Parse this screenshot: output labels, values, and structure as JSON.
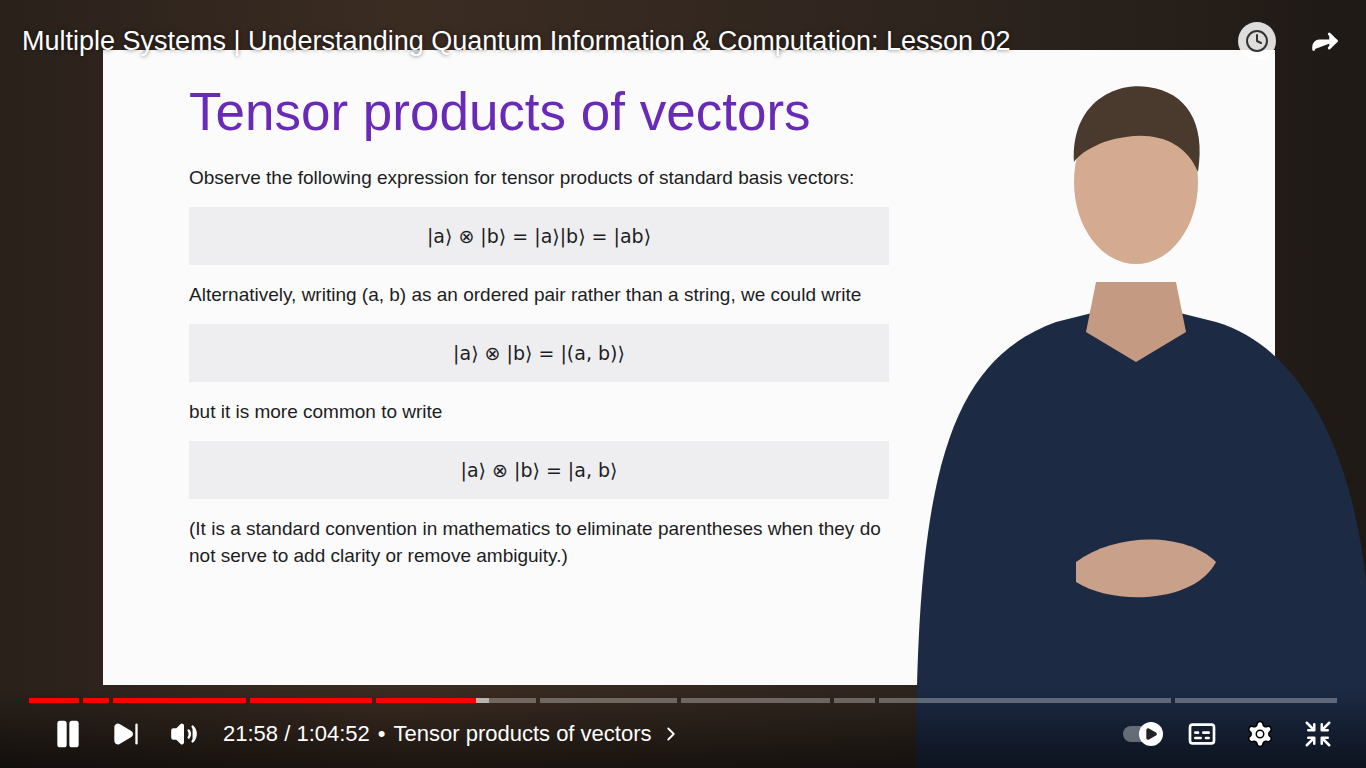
{
  "player": {
    "title": "Multiple Systems | Understanding Quantum Information & Computation: Lesson 02",
    "playing": true,
    "level": 0.3386,
    "buffered": 0.349,
    "time": "21:58 / 1:04:52",
    "separator": "•",
    "chapter": "Tensor products of vectors",
    "autoplay": true
  },
  "chapters": [
    {
      "share": 0.039
    },
    {
      "share": 0.021
    },
    {
      "share": 0.104
    },
    {
      "share": 0.096
    },
    {
      "share": 0.126
    },
    {
      "share": 0.108
    },
    {
      "share": 0.117
    },
    {
      "share": 0.032
    },
    {
      "share": 0.23
    },
    {
      "share": 0.127
    }
  ],
  "slide": {
    "heading": "Tensor products of vectors",
    "blocks": [
      {
        "kind": "text",
        "text": "Observe the following expression for tensor products of standard basis vectors:"
      },
      {
        "kind": "formula",
        "text": "|a⟩ ⊗ |b⟩ = |a⟩|b⟩ = |ab⟩"
      },
      {
        "kind": "text",
        "text": "Alternatively, writing (a, b) as an ordered pair rather than a string, we could write"
      },
      {
        "kind": "formula",
        "text": "|a⟩ ⊗ |b⟩ = |(a, b)⟩"
      },
      {
        "kind": "text",
        "text": "but it is more common to write"
      },
      {
        "kind": "formula",
        "text": "|a⟩ ⊗ |b⟩ = |a, b⟩"
      },
      {
        "kind": "text",
        "text": "(It is a standard convention in mathematics to eliminate parentheses when they do not serve to add clarity or remove ambiguity.)"
      }
    ]
  }
}
